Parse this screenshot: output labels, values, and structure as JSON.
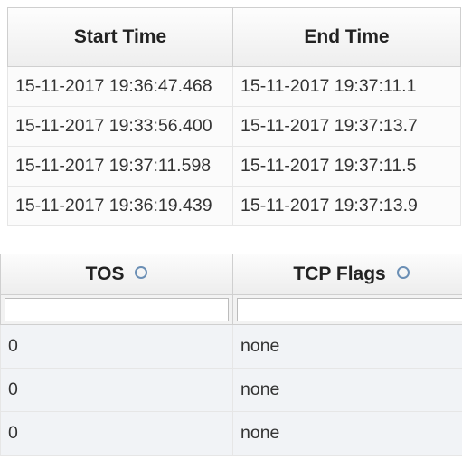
{
  "table1": {
    "headers": {
      "start": "Start Time",
      "end": "End Time"
    },
    "rows": [
      {
        "start": "15-11-2017 19:36:47.468",
        "end": "15-11-2017 19:37:11.1"
      },
      {
        "start": "15-11-2017 19:33:56.400",
        "end": "15-11-2017 19:37:13.7"
      },
      {
        "start": "15-11-2017 19:37:11.598",
        "end": "15-11-2017 19:37:11.5"
      },
      {
        "start": "15-11-2017 19:36:19.439",
        "end": "15-11-2017 19:37:13.9"
      }
    ]
  },
  "table2": {
    "headers": {
      "tos": "TOS",
      "tcp_flags": "TCP Flags"
    },
    "filters": {
      "tos": "",
      "tcp_flags": ""
    },
    "rows": [
      {
        "tos": "0",
        "tcp_flags": "none"
      },
      {
        "tos": "0",
        "tcp_flags": "none"
      },
      {
        "tos": "0",
        "tcp_flags": "none"
      }
    ]
  }
}
